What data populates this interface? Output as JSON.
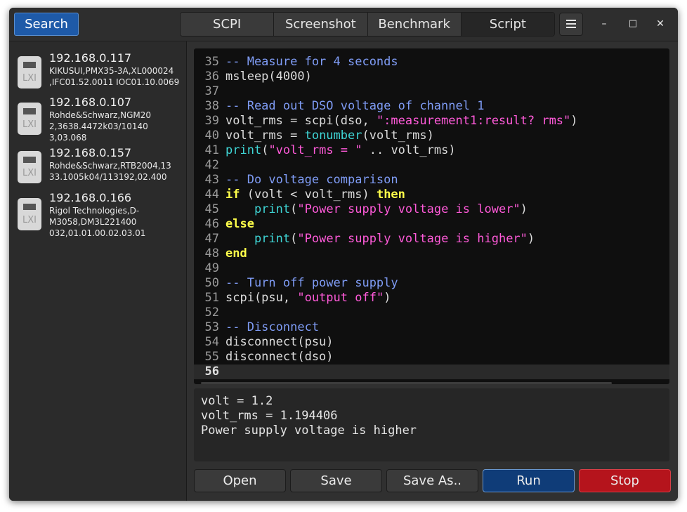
{
  "toolbar": {
    "search_label": "Search",
    "tabs": [
      {
        "label": "SCPI",
        "active": false
      },
      {
        "label": "Screenshot",
        "active": false
      },
      {
        "label": "Benchmark",
        "active": false
      },
      {
        "label": "Script",
        "active": true
      }
    ],
    "menu_icon": "hamburger-icon",
    "minimize_glyph": "–",
    "maximize_glyph": "□",
    "close_glyph": "✕"
  },
  "devices": [
    {
      "ip": "192.168.0.117",
      "description": "KIKUSUI,PMX35-3A,XL000024\n,IFC01.52.0011 IOC01.10.0069",
      "icon_label": "LXI"
    },
    {
      "ip": "192.168.0.107",
      "description": "Rohde&Schwarz,NGM20\n2,3638.4472k03/10140\n3,03.068",
      "icon_label": "LXI"
    },
    {
      "ip": "192.168.0.157",
      "description": "Rohde&Schwarz,RTB2004,13\n33.1005k04/113192,02.400",
      "icon_label": "LXI"
    },
    {
      "ip": "192.168.0.166",
      "description": "Rigol Technologies,D-\nM3058,DM3L221400\n032,01.01.00.02.03.01",
      "icon_label": "LXI"
    }
  ],
  "editor": {
    "current_line": 56,
    "lines": [
      {
        "n": "35",
        "tokens": [
          {
            "t": "-- Measure for 4 seconds",
            "c": "comment"
          }
        ]
      },
      {
        "n": "36",
        "tokens": [
          {
            "t": "msleep(4000)",
            "c": "plain"
          }
        ]
      },
      {
        "n": "37",
        "tokens": []
      },
      {
        "n": "38",
        "tokens": [
          {
            "t": "-- Read out DSO voltage of channel 1",
            "c": "comment"
          }
        ]
      },
      {
        "n": "39",
        "tokens": [
          {
            "t": "volt_rms = scpi(dso, ",
            "c": "plain"
          },
          {
            "t": "\":measurement1:result? rms\"",
            "c": "string"
          },
          {
            "t": ")",
            "c": "plain"
          }
        ]
      },
      {
        "n": "40",
        "tokens": [
          {
            "t": "volt_rms = ",
            "c": "plain"
          },
          {
            "t": "tonumber",
            "c": "builtin"
          },
          {
            "t": "(volt_rms)",
            "c": "plain"
          }
        ]
      },
      {
        "n": "41",
        "tokens": [
          {
            "t": "print",
            "c": "builtin"
          },
          {
            "t": "(",
            "c": "plain"
          },
          {
            "t": "\"volt_rms = \"",
            "c": "string"
          },
          {
            "t": " .. volt_rms)",
            "c": "plain"
          }
        ]
      },
      {
        "n": "42",
        "tokens": []
      },
      {
        "n": "43",
        "tokens": [
          {
            "t": "-- Do voltage comparison",
            "c": "comment"
          }
        ]
      },
      {
        "n": "44",
        "tokens": [
          {
            "t": "if",
            "c": "keyword"
          },
          {
            "t": " (volt < volt_rms) ",
            "c": "plain"
          },
          {
            "t": "then",
            "c": "keyword"
          }
        ]
      },
      {
        "n": "45",
        "tokens": [
          {
            "t": "    ",
            "c": "plain"
          },
          {
            "t": "print",
            "c": "builtin"
          },
          {
            "t": "(",
            "c": "plain"
          },
          {
            "t": "\"Power supply voltage is lower\"",
            "c": "string"
          },
          {
            "t": ")",
            "c": "plain"
          }
        ]
      },
      {
        "n": "46",
        "tokens": [
          {
            "t": "else",
            "c": "keyword"
          }
        ]
      },
      {
        "n": "47",
        "tokens": [
          {
            "t": "    ",
            "c": "plain"
          },
          {
            "t": "print",
            "c": "builtin"
          },
          {
            "t": "(",
            "c": "plain"
          },
          {
            "t": "\"Power supply voltage is higher\"",
            "c": "string"
          },
          {
            "t": ")",
            "c": "plain"
          }
        ]
      },
      {
        "n": "48",
        "tokens": [
          {
            "t": "end",
            "c": "keyword"
          }
        ]
      },
      {
        "n": "49",
        "tokens": []
      },
      {
        "n": "50",
        "tokens": [
          {
            "t": "-- Turn off power supply",
            "c": "comment"
          }
        ]
      },
      {
        "n": "51",
        "tokens": [
          {
            "t": "scpi(psu, ",
            "c": "plain"
          },
          {
            "t": "\"output off\"",
            "c": "string"
          },
          {
            "t": ")",
            "c": "plain"
          }
        ]
      },
      {
        "n": "52",
        "tokens": []
      },
      {
        "n": "53",
        "tokens": [
          {
            "t": "-- Disconnect",
            "c": "comment"
          }
        ]
      },
      {
        "n": "54",
        "tokens": [
          {
            "t": "disconnect(psu)",
            "c": "plain"
          }
        ]
      },
      {
        "n": "55",
        "tokens": [
          {
            "t": "disconnect(dso)",
            "c": "plain"
          }
        ]
      },
      {
        "n": "56",
        "tokens": []
      }
    ]
  },
  "output": {
    "lines": [
      "volt = 1.2",
      "volt_rms = 1.194406",
      "Power supply voltage is higher"
    ]
  },
  "buttons": {
    "open": "Open",
    "save": "Save",
    "save_as": "Save As..",
    "run": "Run",
    "stop": "Stop"
  },
  "colors": {
    "comment": "#7f9cf5",
    "string": "#ff5ad9",
    "builtin": "#3fd6d6",
    "keyword": "#ffff4a",
    "run_button": "#0f3c78",
    "stop_button": "#b5141c",
    "search_button": "#1e5aa8"
  }
}
